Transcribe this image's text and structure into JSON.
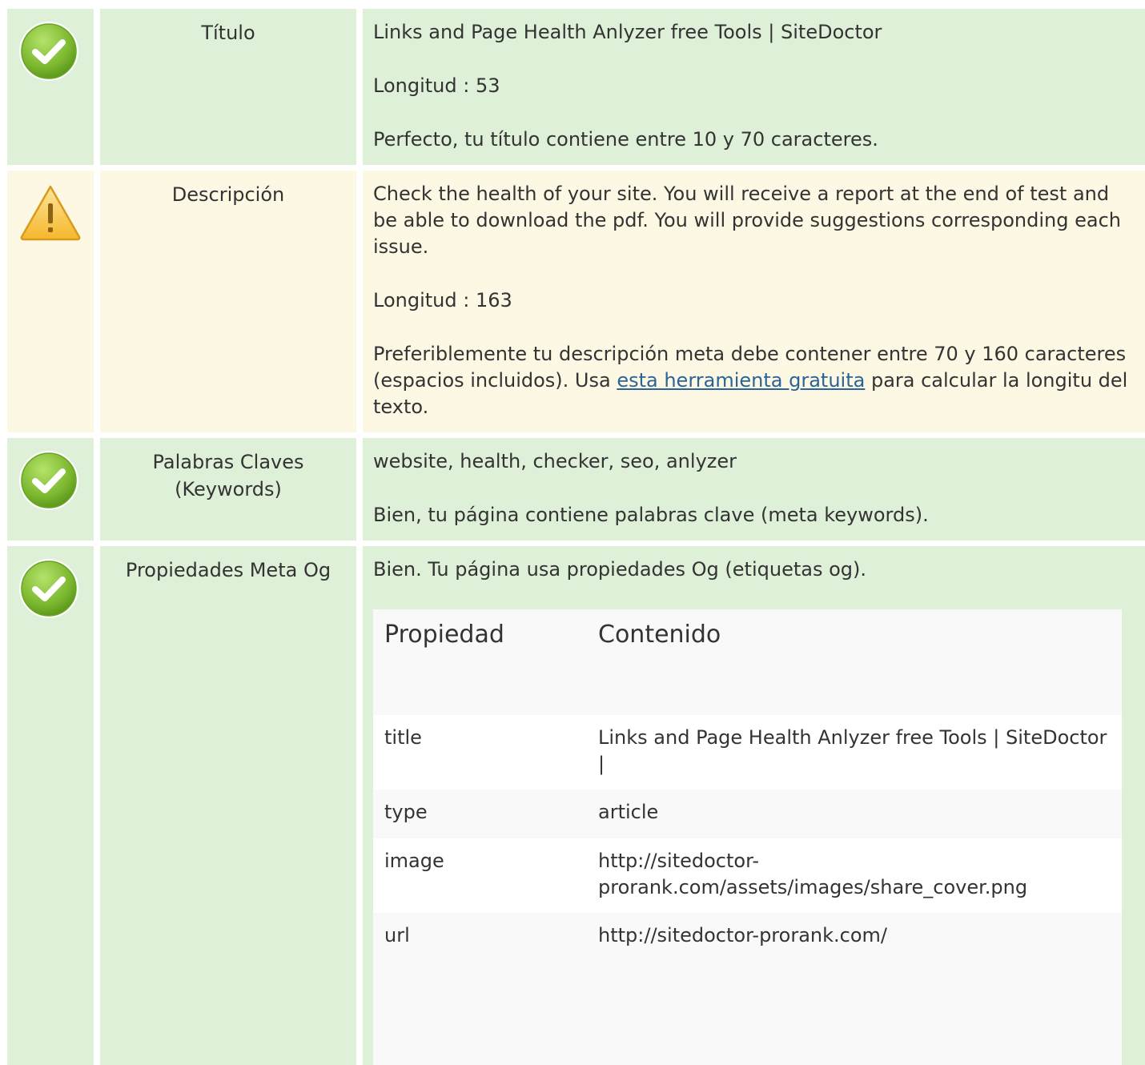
{
  "colors": {
    "ok_background": "#dff0d8",
    "warn_background": "#fcf8e3",
    "ok_icon": "#8bc34a",
    "warn_icon": "#f5c040",
    "link": "#2a6496"
  },
  "rows": {
    "titulo": {
      "status_icon": "check-circle-icon",
      "label": "Título",
      "value": "Links and Page Health Anlyzer free Tools | SiteDoctor",
      "length": "Longitud : 53",
      "message": "Perfecto, tu título contiene entre 10 y 70 caracteres."
    },
    "descripcion": {
      "status_icon": "warning-triangle-icon",
      "label": "Descripción",
      "value": "Check the health of your site. You will receive a report at the end of test and be able to download the pdf. You will provide suggestions corresponding each issue.",
      "length": "Longitud : 163",
      "message_before": "Preferiblemente tu descripción meta debe contener entre 70 y 160 caracteres (espacios incluidos). Usa ",
      "message_link": "esta herramienta gratuita",
      "message_after": " para calcular la longitu del texto."
    },
    "keywords": {
      "status_icon": "check-circle-icon",
      "label": "Palabras Claves (Keywords)",
      "value": "website, health, checker, seo, anlyzer",
      "message": "Bien, tu página contiene palabras clave (meta keywords)."
    },
    "og": {
      "status_icon": "check-circle-icon",
      "label": "Propiedades Meta Og",
      "message": "Bien. Tu página usa propiedades Og (etiquetas og).",
      "table": {
        "header_property": "Propiedad",
        "header_content": "Contenido",
        "rows": [
          {
            "property": "title",
            "content": "Links and Page Health Anlyzer free Tools | SiteDoctor |"
          },
          {
            "property": "type",
            "content": "article"
          },
          {
            "property": "image",
            "content": "http://sitedoctor-prorank.com/assets/images/share_cover.png"
          },
          {
            "property": "url",
            "content": "http://sitedoctor-prorank.com/"
          }
        ]
      }
    }
  }
}
